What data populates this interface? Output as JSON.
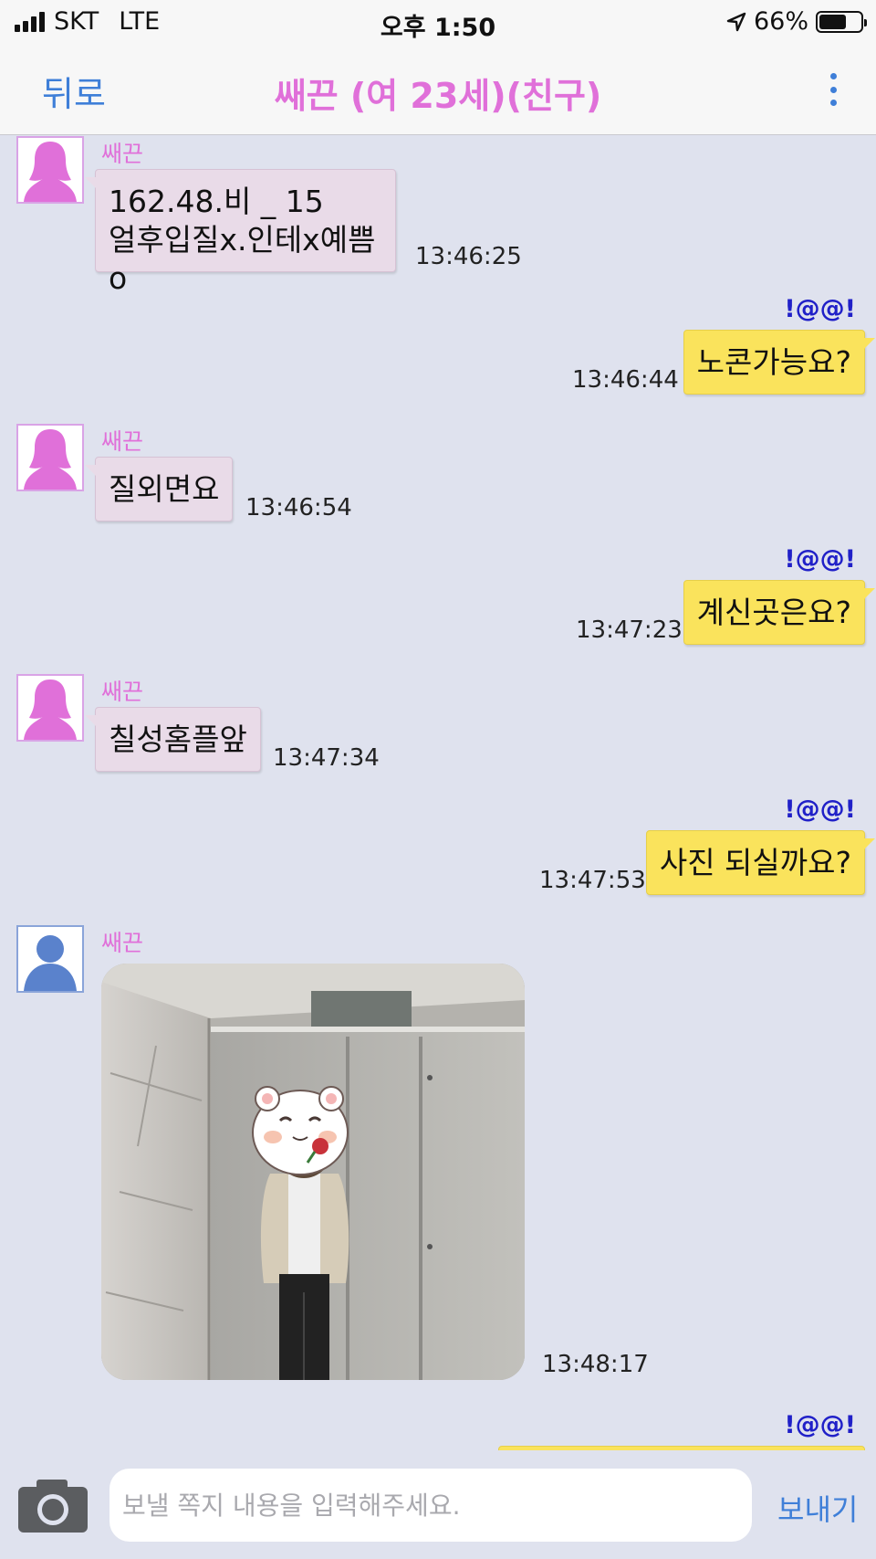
{
  "status_bar": {
    "carrier": "SKT",
    "network": "LTE",
    "time": "오후 1:50",
    "battery": "66%",
    "battery_level": 0.66
  },
  "nav": {
    "back_label": "뒤로",
    "title": "쌔끈 (여 23세)(친구)",
    "more_icon": "vertical-dots-icon"
  },
  "colors": {
    "accent_pink": "#e070d9",
    "link_blue": "#3f7fd8",
    "outgoing_bubble": "#fae35c",
    "incoming_bubble": "#e9dbe8",
    "background": "#dfe2ee"
  },
  "messages": [
    {
      "direction": "in",
      "sender": "쌔끈",
      "lines": [
        "162.48.비 _ 15",
        "얼후입질x.인테x예쁨o"
      ],
      "time": "13:46:25"
    },
    {
      "direction": "out",
      "sender": "!@@!",
      "text": "노콘가능요?",
      "time": "13:46:44"
    },
    {
      "direction": "in",
      "sender": "쌔끈",
      "text": "질외면요",
      "time": "13:46:54"
    },
    {
      "direction": "out",
      "sender": "!@@!",
      "text": "계신곳은요?",
      "time": "13:47:23"
    },
    {
      "direction": "in",
      "sender": "쌔끈",
      "text": "칠성홈플앞",
      "time": "13:47:34"
    },
    {
      "direction": "out",
      "sender": "!@@!",
      "text": "사진 되실까요?",
      "time": "13:47:53"
    },
    {
      "direction": "in",
      "sender": "쌔끈",
      "type": "photo",
      "time": "13:48:17"
    },
    {
      "direction": "out",
      "sender": "!@@!"
    }
  ],
  "composer": {
    "camera_icon": "camera-icon",
    "placeholder": "보낼 쪽지 내용을 입력해주세요.",
    "value": "",
    "send_label": "보내기"
  }
}
